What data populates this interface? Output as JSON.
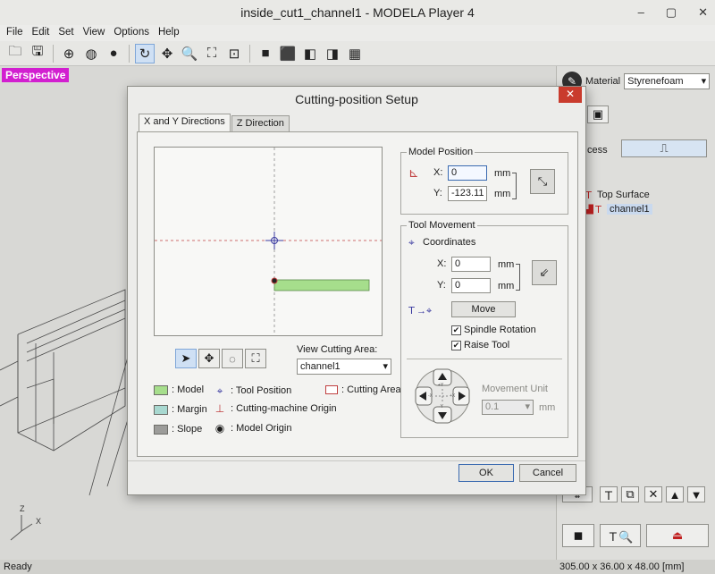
{
  "window": {
    "title": "inside_cut1_channel1 - MODELA Player 4",
    "controls": [
      "–",
      "▢",
      "✕"
    ]
  },
  "menu": [
    "File",
    "Edit",
    "Set",
    "View",
    "Options",
    "Help"
  ],
  "viewport": {
    "mode_label": "Perspective",
    "axes_label": "Z\nX"
  },
  "right_panel": {
    "material_label": "Material",
    "material_value": "Styrenefoam",
    "process_label": "cess",
    "tree": [
      "Top Surface",
      "channel1"
    ]
  },
  "status": {
    "left": "Ready",
    "dimensions": "305.00 x 36.00 x 48.00 [mm]"
  },
  "dialog": {
    "title": "Cutting-position Setup",
    "close": "✕",
    "tabs": [
      "X and Y Directions",
      "Z Direction"
    ],
    "view_cutting_area_label": "View Cutting Area:",
    "view_cutting_area_value": "channel1",
    "legend": {
      "model": ": Model",
      "margin": ": Margin",
      "slope": ": Slope",
      "tool_position": ": Tool Position",
      "machine_origin": ": Cutting-machine Origin",
      "model_origin": ": Model Origin",
      "cutting_area": ": Cutting Area"
    },
    "model_position": {
      "title": "Model Position",
      "x_label": "X:",
      "x_value": "0",
      "y_label": "Y:",
      "y_value": "-123.11",
      "unit": "mm"
    },
    "tool_movement": {
      "title": "Tool Movement",
      "coordinates_label": "Coordinates",
      "x_label": "X:",
      "x_value": "0",
      "y_label": "Y:",
      "y_value": "0",
      "unit": "mm",
      "move_button": "Move",
      "spindle_rotation": "Spindle Rotation",
      "raise_tool": "Raise Tool",
      "movement_unit_label": "Movement Unit",
      "movement_unit_value": "0.1",
      "movement_unit_unit": "mm",
      "dpad_plus_y": "+Y",
      "dpad_minus_y": "-Y",
      "dpad_plus_x": "+X",
      "dpad_minus_x": "-X"
    },
    "ok": "OK",
    "cancel": "Cancel"
  },
  "colors": {
    "model": "#a6de8c",
    "margin": "#a8d8d0",
    "slope": "#9c9c9a",
    "accent_magenta": "#d21fd0",
    "close_red": "#c93b2d"
  }
}
